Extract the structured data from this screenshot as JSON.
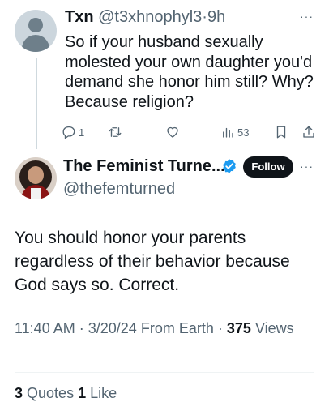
{
  "reply": {
    "name": "Txn",
    "handle": "@t3xhnophyl3",
    "separator": "·",
    "time": "9h",
    "more": "···",
    "text": "So if your husband sexually molested your own daughter you'd demand she honor him still? Why? Because religion?",
    "actions": {
      "reply_count": "1",
      "retweet_count": "",
      "like_count": "",
      "views_count": "53"
    }
  },
  "main": {
    "name": "The Feminist Turne...",
    "handle": "@thefemturned",
    "follow_label": "Follow",
    "more": "···",
    "text": "You should honor your parents regardless of their behavior because God says so. Correct.",
    "meta": {
      "time": "11:40 AM",
      "dot1": "·",
      "date": "3/20/24",
      "source": "From Earth",
      "dot2": "·",
      "views_count": "375",
      "views_label": "Views"
    },
    "stats": {
      "quotes_count": "3",
      "quotes_label": "Quotes",
      "likes_count": "1",
      "likes_label": "Like"
    }
  },
  "colors": {
    "text": "#0f1419",
    "secondary": "#536471",
    "verified": "#1d9bf0",
    "follow_bg": "#0f1419"
  }
}
